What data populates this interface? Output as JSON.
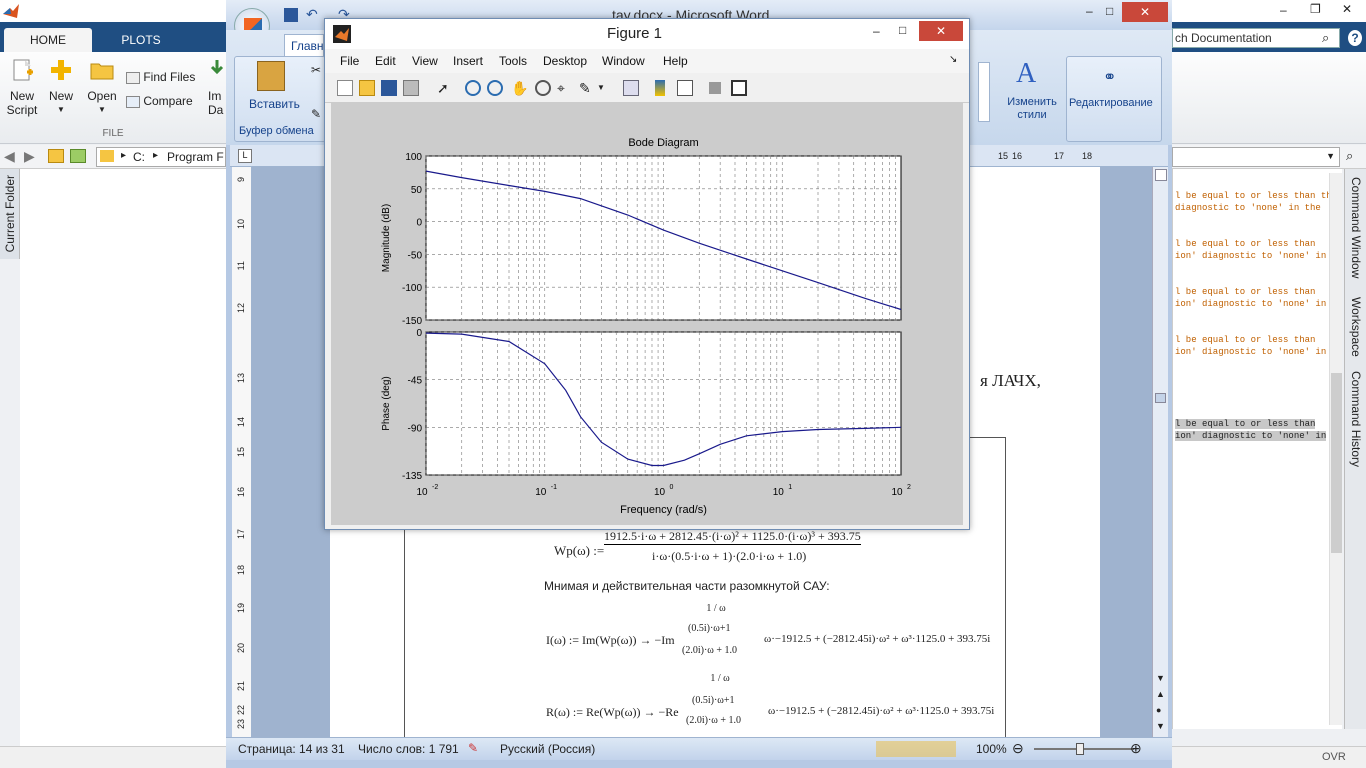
{
  "matlab": {
    "tabs": [
      "HOME",
      "PLOTS"
    ],
    "ribbon": {
      "new_script": "New\nScript",
      "new": "New",
      "open": "Open",
      "find_files": "Find Files",
      "compare": "Compare",
      "import_partial": "Im\nDa",
      "group_label": "FILE"
    },
    "path": [
      "C:",
      "Program F"
    ],
    "current_folder_tab": "Current Folder",
    "search_docs": "ch Documentation",
    "command_lines": [
      "l be equal to or less than this",
      "diagnostic to 'none' in the",
      "l be equal to or less than",
      "ion' diagnostic to 'none' in",
      "l be equal to or less than",
      "ion' diagnostic to 'none' in",
      "l be equal to or less than",
      "ion' diagnostic to 'none' in",
      "l be equal to or less than",
      "ion' diagnostic to 'none' in"
    ],
    "side_tabs": [
      "Command Window",
      "Workspace",
      "Command History"
    ],
    "status": "OVR"
  },
  "word": {
    "title": "tay.docx - Microsoft Word",
    "tab_partial": "Главна",
    "paste": "Вставить",
    "clipboard": "Буфер обмена",
    "change_styles": "Изменить\nстили",
    "editing": "Редактирование",
    "ruler_marks": [
      "15",
      "16",
      "17",
      "18"
    ],
    "vruler": [
      "9",
      "10",
      "11",
      "12",
      "13",
      "14",
      "15",
      "16",
      "17",
      "18",
      "19",
      "20",
      "21",
      "22",
      "23"
    ],
    "doc_text_lachx": "я ЛАЧХ,",
    "formula_wp_lhs": "Wp(ω) :=",
    "formula_wp_num": "1912.5·i·ω + 2812.45·(i·ω)² + 1125.0·(i·ω)³ + 393.75",
    "formula_wp_den": "i·ω·(0.5·i·ω + 1)·(2.0·i·ω + 1.0)",
    "para_text": "Мнимая и действительная части разомкнутой САУ:",
    "formula_im": "I(ω) := Im(Wp(ω)) → −Im",
    "formula_re": "R(ω) := Re(Wp(ω)) → −Re",
    "frac_one_w": "1 / ω",
    "frac_mid": "(0.5i)·ω+1",
    "frac_den": "(2.0i)·ω + 1.0",
    "bracket_expr": "ω·−1912.5 + (−2812.45i)·ω² + ω³·1125.0 + 393.75i",
    "status": {
      "page": "Страница: 14 из 31",
      "words": "Число слов: 1 791",
      "lang": "Русский (Россия)",
      "zoom": "100%"
    }
  },
  "figure": {
    "title": "Figure 1",
    "menu": [
      "File",
      "Edit",
      "View",
      "Insert",
      "Tools",
      "Desktop",
      "Window",
      "Help"
    ]
  },
  "chart_data": {
    "type": "line",
    "title": "Bode Diagram",
    "xlabel": "Frequency  (rad/s)",
    "xscale": "log",
    "xlim": [
      0.01,
      100
    ],
    "x_ticks": [
      "10^-2",
      "10^-1",
      "10^0",
      "10^1",
      "10^2"
    ],
    "grid": true,
    "subplots": [
      {
        "name": "magnitude",
        "ylabel": "Magnitude (dB)",
        "ylim": [
          -150,
          100
        ],
        "y_ticks": [
          100,
          50,
          0,
          -50,
          -100,
          -150
        ],
        "x": [
          0.01,
          0.02,
          0.05,
          0.1,
          0.2,
          0.5,
          1,
          2,
          5,
          10,
          20,
          50,
          100
        ],
        "y": [
          77,
          67,
          55,
          46,
          35,
          10,
          -13,
          -33,
          -57,
          -75,
          -93,
          -117,
          -134
        ]
      },
      {
        "name": "phase",
        "ylabel": "Phase (deg)",
        "ylim": [
          -135,
          0
        ],
        "y_ticks": [
          0,
          -45,
          -90,
          -135
        ],
        "x": [
          0.01,
          0.02,
          0.05,
          0.1,
          0.15,
          0.2,
          0.3,
          0.5,
          0.8,
          1,
          1.5,
          2,
          3,
          5,
          10,
          20,
          50,
          100
        ],
        "y": [
          -1,
          -2,
          -9,
          -30,
          -55,
          -80,
          -104,
          -120,
          -126,
          -126,
          -121,
          -115,
          -106,
          -98,
          -94,
          -92,
          -91,
          -90
        ]
      }
    ]
  }
}
